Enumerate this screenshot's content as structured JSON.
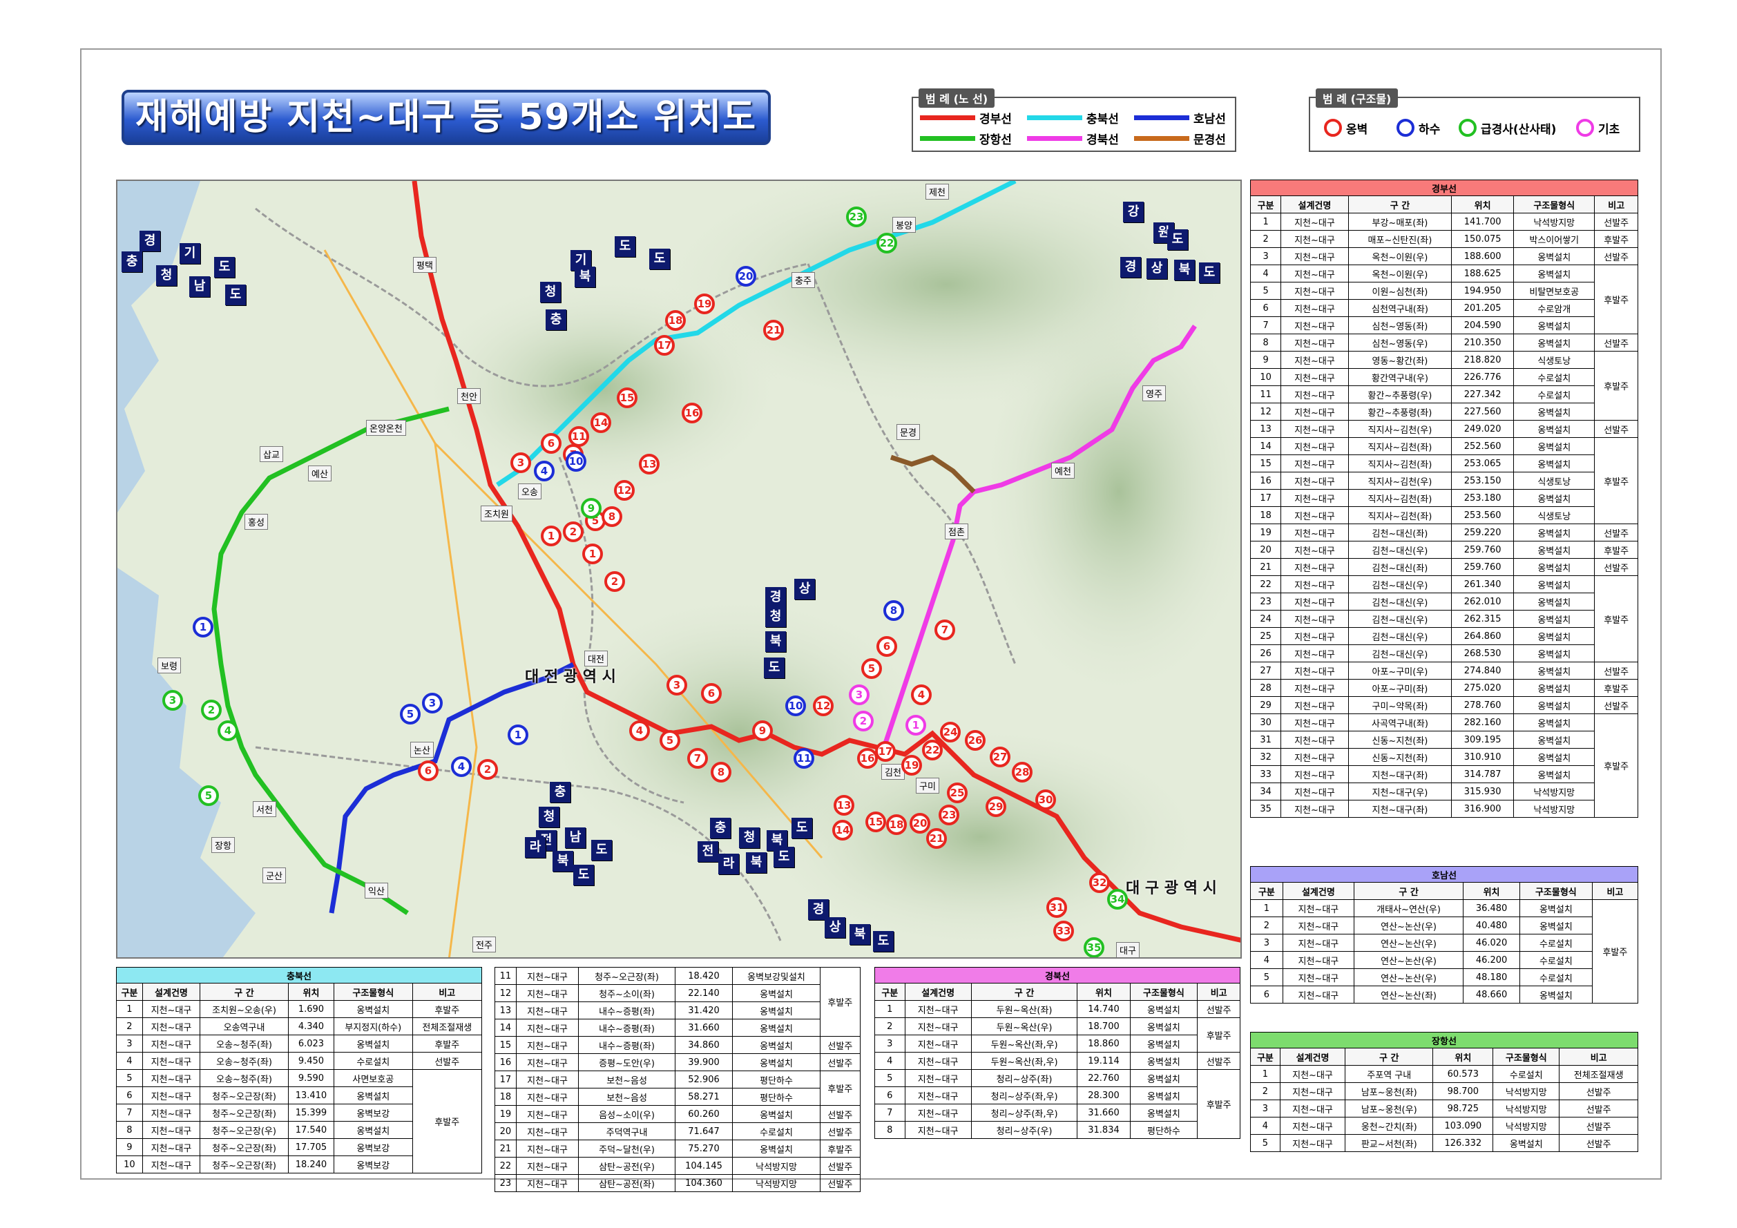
{
  "title": "재해예방 지천~대구 등 59개소 위치도",
  "legend_lines": {
    "header": "범 례 (노 선)",
    "items": [
      {
        "label": "경부선",
        "color": "#e8261f"
      },
      {
        "label": "충북선",
        "color": "#22d8e8"
      },
      {
        "label": "호남선",
        "color": "#1c2ed6"
      },
      {
        "label": "장항선",
        "color": "#22c022"
      },
      {
        "label": "경북선",
        "color": "#ef3be6"
      },
      {
        "label": "문경선",
        "color": "#c86a1c"
      }
    ]
  },
  "legend_structures": {
    "header": "범 례 (구조물)",
    "items": [
      {
        "label": "옹벽",
        "color": "#e8261f"
      },
      {
        "label": "하수",
        "color": "#1c2ed6"
      },
      {
        "label": "급경사(산사태)",
        "color": "#22c022"
      },
      {
        "label": "기초",
        "color": "#ef3be6"
      }
    ]
  },
  "map": {
    "region_labels": [
      "경",
      "기",
      "도",
      "충",
      "청",
      "남",
      "도",
      "기",
      "도",
      "청",
      "북",
      "도",
      "충",
      "강",
      "원",
      "도",
      "경",
      "상",
      "북",
      "도",
      "경",
      "상",
      "청",
      "북",
      "도",
      "충",
      "청",
      "남",
      "도",
      "전",
      "라",
      "북",
      "도",
      "충",
      "청",
      "북",
      "도",
      "전",
      "라",
      "북",
      "도",
      "경",
      "상",
      "북",
      "도"
    ],
    "cities": [
      "제천",
      "평택",
      "봉양",
      "충주",
      "천안",
      "온양온천",
      "삽교",
      "예산",
      "홍성",
      "조치원",
      "오송",
      "대전",
      "보령",
      "논산",
      "서천",
      "장항",
      "군산",
      "익산",
      "전주",
      "김천",
      "구미",
      "점촌",
      "예천",
      "영주",
      "문경",
      "대구"
    ],
    "metro_labels": [
      "대 전 광 역 시",
      "대 구 광 역 시"
    ],
    "markers": [
      {
        "n": "1",
        "c": "#e8261f"
      },
      {
        "n": "2",
        "c": "#e8261f"
      },
      {
        "n": "3",
        "c": "#e8261f"
      },
      {
        "n": "4",
        "c": "#e8261f"
      },
      {
        "n": "5",
        "c": "#e8261f"
      },
      {
        "n": "6",
        "c": "#e8261f"
      },
      {
        "n": "7",
        "c": "#e8261f"
      },
      {
        "n": "8",
        "c": "#e8261f"
      },
      {
        "n": "9",
        "c": "#e8261f"
      },
      {
        "n": "10",
        "c": "#1c2ed6"
      },
      {
        "n": "11",
        "c": "#1c2ed6"
      },
      {
        "n": "12",
        "c": "#e8261f"
      },
      {
        "n": "13",
        "c": "#e8261f"
      },
      {
        "n": "14",
        "c": "#e8261f"
      },
      {
        "n": "15",
        "c": "#e8261f"
      },
      {
        "n": "16",
        "c": "#e8261f"
      },
      {
        "n": "17",
        "c": "#e8261f"
      },
      {
        "n": "18",
        "c": "#e8261f"
      },
      {
        "n": "19",
        "c": "#e8261f"
      },
      {
        "n": "20",
        "c": "#e8261f"
      },
      {
        "n": "21",
        "c": "#e8261f"
      },
      {
        "n": "22",
        "c": "#e8261f"
      },
      {
        "n": "23",
        "c": "#e8261f"
      },
      {
        "n": "24",
        "c": "#e8261f"
      },
      {
        "n": "25",
        "c": "#e8261f"
      },
      {
        "n": "26",
        "c": "#e8261f"
      },
      {
        "n": "27",
        "c": "#e8261f"
      },
      {
        "n": "28",
        "c": "#e8261f"
      },
      {
        "n": "29",
        "c": "#e8261f"
      },
      {
        "n": "30",
        "c": "#e8261f"
      },
      {
        "n": "31",
        "c": "#e8261f"
      },
      {
        "n": "32",
        "c": "#e8261f"
      },
      {
        "n": "33",
        "c": "#e8261f"
      },
      {
        "n": "34",
        "c": "#22c022"
      },
      {
        "n": "35",
        "c": "#22c022"
      },
      {
        "n": "1",
        "c": "#e8261f"
      },
      {
        "n": "2",
        "c": "#e8261f"
      },
      {
        "n": "3",
        "c": "#e8261f"
      },
      {
        "n": "4",
        "c": "#1c2ed6"
      },
      {
        "n": "5",
        "c": "#e8261f"
      },
      {
        "n": "6",
        "c": "#e8261f"
      },
      {
        "n": "7",
        "c": "#e8261f"
      },
      {
        "n": "8",
        "c": "#e8261f"
      },
      {
        "n": "9",
        "c": "#22c022"
      },
      {
        "n": "10",
        "c": "#1c2ed6"
      },
      {
        "n": "11",
        "c": "#e8261f"
      },
      {
        "n": "12",
        "c": "#e8261f"
      },
      {
        "n": "13",
        "c": "#e8261f"
      },
      {
        "n": "14",
        "c": "#e8261f"
      },
      {
        "n": "15",
        "c": "#e8261f"
      },
      {
        "n": "16",
        "c": "#e8261f"
      },
      {
        "n": "17",
        "c": "#e8261f"
      },
      {
        "n": "18",
        "c": "#e8261f"
      },
      {
        "n": "19",
        "c": "#e8261f"
      },
      {
        "n": "20",
        "c": "#1c2ed6"
      },
      {
        "n": "21",
        "c": "#e8261f"
      },
      {
        "n": "22",
        "c": "#22c022"
      },
      {
        "n": "23",
        "c": "#22c022"
      },
      {
        "n": "1",
        "c": "#1c2ed6"
      },
      {
        "n": "2",
        "c": "#e8261f"
      },
      {
        "n": "3",
        "c": "#1c2ed6"
      },
      {
        "n": "4",
        "c": "#1c2ed6"
      },
      {
        "n": "5",
        "c": "#1c2ed6"
      },
      {
        "n": "6",
        "c": "#e8261f"
      },
      {
        "n": "1",
        "c": "#ef3be6"
      },
      {
        "n": "2",
        "c": "#ef3be6"
      },
      {
        "n": "3",
        "c": "#ef3be6"
      },
      {
        "n": "4",
        "c": "#e8261f"
      },
      {
        "n": "5",
        "c": "#e8261f"
      },
      {
        "n": "6",
        "c": "#e8261f"
      },
      {
        "n": "7",
        "c": "#e8261f"
      },
      {
        "n": "8",
        "c": "#1c2ed6"
      },
      {
        "n": "1",
        "c": "#1c2ed6"
      },
      {
        "n": "2",
        "c": "#22c022"
      },
      {
        "n": "3",
        "c": "#22c022"
      },
      {
        "n": "4",
        "c": "#22c022"
      },
      {
        "n": "5",
        "c": "#22c022"
      }
    ]
  },
  "columns": [
    "구분",
    "설계건명",
    "구 간",
    "위치",
    "구조물형식",
    "비고"
  ],
  "gyeongbu": {
    "title": "경부선",
    "rows": [
      [
        "1",
        "지천~대구",
        "부강~매포(좌)",
        "141.700",
        "낙석방지망",
        "선발주"
      ],
      [
        "2",
        "지천~대구",
        "매포~신탄진(좌)",
        "150.075",
        "박스이어쌓기",
        "후발주"
      ],
      [
        "3",
        "지천~대구",
        "옥천~이원(우)",
        "188.600",
        "옹벽설치",
        "선발주"
      ],
      [
        "4",
        "지천~대구",
        "옥천~이원(우)",
        "188.625",
        "옹벽설치",
        ""
      ],
      [
        "5",
        "지천~대구",
        "이원~심천(좌)",
        "194.950",
        "비탈면보호공",
        ""
      ],
      [
        "6",
        "지천~대구",
        "심천역구내(좌)",
        "201.205",
        "수로암개",
        ""
      ],
      [
        "7",
        "지천~대구",
        "심천~영동(좌)",
        "204.590",
        "옹벽설치",
        ""
      ],
      [
        "8",
        "지천~대구",
        "심천~영동(우)",
        "210.350",
        "옹벽설치",
        "선발주"
      ],
      [
        "9",
        "지천~대구",
        "영동~황간(좌)",
        "218.820",
        "식생토낭",
        ""
      ],
      [
        "10",
        "지천~대구",
        "황간역구내(우)",
        "226.776",
        "수로설치",
        ""
      ],
      [
        "11",
        "지천~대구",
        "황간~추풍령(우)",
        "227.342",
        "수로설치",
        ""
      ],
      [
        "12",
        "지천~대구",
        "황간~추풍령(좌)",
        "227.560",
        "옹벽설치",
        ""
      ],
      [
        "13",
        "지천~대구",
        "직지사~김천(우)",
        "249.020",
        "옹벽설치",
        "선발주"
      ],
      [
        "14",
        "지천~대구",
        "직지사~김천(좌)",
        "252.560",
        "옹벽설치",
        ""
      ],
      [
        "15",
        "지천~대구",
        "직지사~김천(좌)",
        "253.065",
        "옹벽설치",
        ""
      ],
      [
        "16",
        "지천~대구",
        "직지사~김천(우)",
        "253.150",
        "식생토낭",
        ""
      ],
      [
        "17",
        "지천~대구",
        "직지사~김천(좌)",
        "253.180",
        "옹벽설치",
        ""
      ],
      [
        "18",
        "지천~대구",
        "직지사~김천(좌)",
        "253.560",
        "식생토낭",
        ""
      ],
      [
        "19",
        "지천~대구",
        "김천~대신(좌)",
        "259.220",
        "옹벽설치",
        "선발주"
      ],
      [
        "20",
        "지천~대구",
        "김천~대신(우)",
        "259.760",
        "옹벽설치",
        "후발주"
      ],
      [
        "21",
        "지천~대구",
        "김천~대신(좌)",
        "259.760",
        "옹벽설치",
        "선발주"
      ],
      [
        "22",
        "지천~대구",
        "김천~대신(우)",
        "261.340",
        "옹벽설치",
        ""
      ],
      [
        "23",
        "지천~대구",
        "김천~대신(우)",
        "262.010",
        "옹벽설치",
        ""
      ],
      [
        "24",
        "지천~대구",
        "김천~대신(우)",
        "262.315",
        "옹벽설치",
        ""
      ],
      [
        "25",
        "지천~대구",
        "김천~대신(우)",
        "264.860",
        "옹벽설치",
        ""
      ],
      [
        "26",
        "지천~대구",
        "김천~대신(우)",
        "268.530",
        "옹벽설치",
        ""
      ],
      [
        "27",
        "지천~대구",
        "아포~구미(우)",
        "274.840",
        "옹벽설치",
        "선발주"
      ],
      [
        "28",
        "지천~대구",
        "아포~구미(좌)",
        "275.020",
        "옹벽설치",
        "후발주"
      ],
      [
        "29",
        "지천~대구",
        "구미~약목(좌)",
        "278.760",
        "옹벽설치",
        "선발주"
      ],
      [
        "30",
        "지천~대구",
        "사곡역구내(좌)",
        "282.160",
        "옹벽설치",
        ""
      ],
      [
        "31",
        "지천~대구",
        "신동~지천(좌)",
        "309.195",
        "옹벽설치",
        ""
      ],
      [
        "32",
        "지천~대구",
        "신동~지천(좌)",
        "310.910",
        "옹벽설치",
        ""
      ],
      [
        "33",
        "지천~대구",
        "지천~대구(좌)",
        "314.787",
        "옹벽설치",
        ""
      ],
      [
        "34",
        "지천~대구",
        "지천~대구(우)",
        "315.930",
        "낙석방지망",
        ""
      ],
      [
        "35",
        "지천~대구",
        "지천~대구(좌)",
        "316.900",
        "낙석방지망",
        ""
      ]
    ],
    "merged_remarks": [
      "후발주",
      "후발주",
      "후발주",
      "후발주",
      "후발주"
    ]
  },
  "honam": {
    "title": "호남선",
    "rows": [
      [
        "1",
        "지천~대구",
        "개태사~연산(우)",
        "36.480",
        "옹벽설치",
        ""
      ],
      [
        "2",
        "지천~대구",
        "연산~논산(우)",
        "40.480",
        "옹벽설치",
        ""
      ],
      [
        "3",
        "지천~대구",
        "연산~논산(우)",
        "46.020",
        "수로설치",
        ""
      ],
      [
        "4",
        "지천~대구",
        "연산~논산(우)",
        "46.200",
        "수로설치",
        ""
      ],
      [
        "5",
        "지천~대구",
        "연산~논산(우)",
        "48.180",
        "수로설치",
        ""
      ],
      [
        "6",
        "지천~대구",
        "연산~논산(좌)",
        "48.660",
        "옹벽설치",
        ""
      ]
    ],
    "merged_remark": "후발주"
  },
  "janghang": {
    "title": "장항선",
    "rows": [
      [
        "1",
        "지천~대구",
        "주포역 구내",
        "60.573",
        "수로설치",
        "전체조절재생"
      ],
      [
        "2",
        "지천~대구",
        "남포~웅천(좌)",
        "98.700",
        "낙석방지망",
        "선발주"
      ],
      [
        "3",
        "지천~대구",
        "남포~웅천(우)",
        "98.725",
        "낙석방지망",
        "선발주"
      ],
      [
        "4",
        "지천~대구",
        "웅천~간치(좌)",
        "103.090",
        "낙석방지망",
        "선발주"
      ],
      [
        "5",
        "지천~대구",
        "판교~서천(좌)",
        "126.332",
        "옹벽설치",
        "선발주"
      ]
    ]
  },
  "chungbuk": {
    "title": "충북선",
    "rows": [
      [
        "1",
        "지천~대구",
        "조치원~오송(우)",
        "1.690",
        "옹벽설치",
        "후발주"
      ],
      [
        "2",
        "지천~대구",
        "오송역구내",
        "4.340",
        "부지정지(하수)",
        "전체조절재생"
      ],
      [
        "3",
        "지천~대구",
        "오송~청주(좌)",
        "6.023",
        "옹벽설치",
        "후발주"
      ],
      [
        "4",
        "지천~대구",
        "오송~청주(좌)",
        "9.450",
        "수로설치",
        "선발주"
      ],
      [
        "5",
        "지천~대구",
        "오송~청주(좌)",
        "9.590",
        "사면보호공",
        ""
      ],
      [
        "6",
        "지천~대구",
        "청주~오근장(좌)",
        "13.410",
        "옹벽설치",
        ""
      ],
      [
        "7",
        "지천~대구",
        "청주~오근장(좌)",
        "15.399",
        "옹벽보강",
        ""
      ],
      [
        "8",
        "지천~대구",
        "청주~오근장(우)",
        "17.540",
        "옹벽설치",
        ""
      ],
      [
        "9",
        "지천~대구",
        "청주~오근장(좌)",
        "17.705",
        "옹벽보강",
        ""
      ],
      [
        "10",
        "지천~대구",
        "청주~오근장(좌)",
        "18.240",
        "옹벽보강",
        ""
      ],
      [
        "11",
        "지천~대구",
        "청주~오근장(좌)",
        "18.420",
        "옹벽보강및설치",
        ""
      ],
      [
        "12",
        "지천~대구",
        "청주~소이(좌)",
        "22.140",
        "옹벽설치",
        ""
      ],
      [
        "13",
        "지천~대구",
        "내수~증평(좌)",
        "31.420",
        "옹벽설치",
        ""
      ],
      [
        "14",
        "지천~대구",
        "내수~증평(좌)",
        "31.660",
        "옹벽설치",
        ""
      ],
      [
        "15",
        "지천~대구",
        "내수~증평(좌)",
        "34.860",
        "옹벽설치",
        "선발주"
      ],
      [
        "16",
        "지천~대구",
        "증평~도안(우)",
        "39.900",
        "옹벽설치",
        "선발주"
      ],
      [
        "17",
        "지천~대구",
        "보천~음성",
        "52.906",
        "평단하수",
        ""
      ],
      [
        "18",
        "지천~대구",
        "보천~음성",
        "58.271",
        "평단하수",
        ""
      ],
      [
        "19",
        "지천~대구",
        "음성~소이(우)",
        "60.260",
        "옹벽설치",
        "선발주"
      ],
      [
        "20",
        "지천~대구",
        "주덕역구내",
        "71.647",
        "수로설치",
        "선발주"
      ],
      [
        "21",
        "지천~대구",
        "주덕~달천(우)",
        "75.270",
        "옹벽설치",
        "후발주"
      ],
      [
        "22",
        "지천~대구",
        "삼탄~공전(우)",
        "104.145",
        "낙석방지망",
        "선발주"
      ],
      [
        "23",
        "지천~대구",
        "삼탄~공전(좌)",
        "104.360",
        "낙석방지망",
        "선발주"
      ]
    ],
    "merged_remarks": [
      "후발주",
      "후발주",
      "후발주"
    ]
  },
  "gyeongbuk": {
    "title": "경북선",
    "rows": [
      [
        "1",
        "지천~대구",
        "두원~옥산(좌)",
        "14.740",
        "옹벽설치",
        "선발주"
      ],
      [
        "2",
        "지천~대구",
        "두원~옥산(우)",
        "18.700",
        "옹벽설치",
        ""
      ],
      [
        "3",
        "지천~대구",
        "두원~옥산(좌,우)",
        "18.860",
        "옹벽설치",
        ""
      ],
      [
        "4",
        "지천~대구",
        "두원~옥산(좌,우)",
        "19.114",
        "옹벽설치",
        "선발주"
      ],
      [
        "5",
        "지천~대구",
        "청리~상주(좌)",
        "22.760",
        "옹벽설치",
        ""
      ],
      [
        "6",
        "지천~대구",
        "청리~상주(좌,우)",
        "28.300",
        "옹벽설치",
        ""
      ],
      [
        "7",
        "지천~대구",
        "청리~상주(좌,우)",
        "31.660",
        "옹벽설치",
        ""
      ],
      [
        "8",
        "지천~대구",
        "청리~상주(우)",
        "31.834",
        "평단하수",
        ""
      ]
    ],
    "merged_remarks": [
      "후발주",
      "후발주"
    ]
  },
  "colors": {
    "gyeongbu_head": "#f87a7a",
    "honam_head": "#a9a2f8",
    "janghang_head": "#7ddc6e",
    "chungbuk_head": "#8de8f2",
    "gyeongbuk_head": "#f07ce8"
  }
}
